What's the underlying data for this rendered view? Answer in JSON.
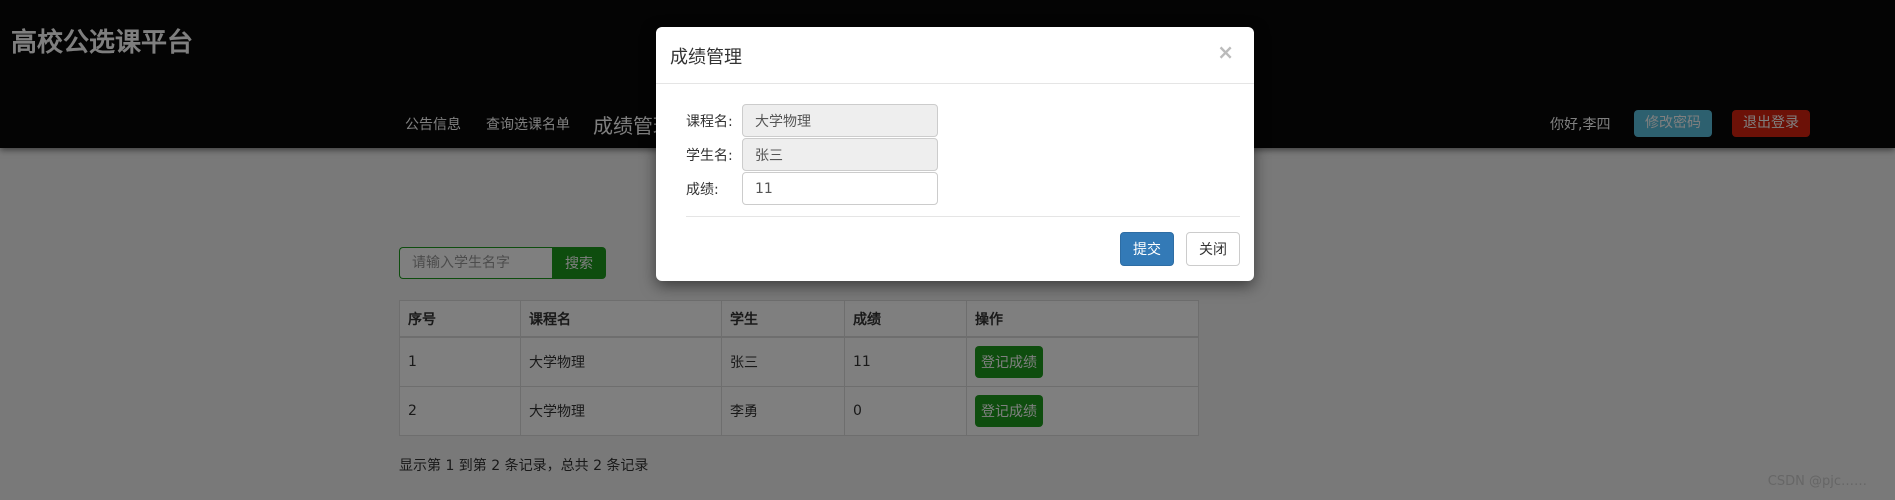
{
  "header": {
    "title": "高校公选课平台",
    "nav": [
      "公告信息",
      "查询选课名单",
      "成绩管理"
    ],
    "greeting": "你好,李四",
    "change_password": "修改密码",
    "logout": "退出登录"
  },
  "search": {
    "placeholder": "请输入学生名字",
    "button": "搜索"
  },
  "table": {
    "headers": [
      "序号",
      "课程名",
      "学生",
      "成绩",
      "操作"
    ],
    "rows": [
      {
        "index": "1",
        "course": "大学物理",
        "student": "张三",
        "score": "11",
        "action": "登记成绩"
      },
      {
        "index": "2",
        "course": "大学物理",
        "student": "李勇",
        "score": "0",
        "action": "登记成绩"
      }
    ]
  },
  "pagination": {
    "info": "显示第 1 到第 2 条记录，总共 2 条记录"
  },
  "watermark": "CSDN @pjc……",
  "modal": {
    "title": "成绩管理",
    "close_symbol": "×",
    "fields": [
      {
        "label": "课程名:",
        "value": "大学物理"
      },
      {
        "label": "学生名:",
        "value": "张三"
      },
      {
        "label": "成绩:",
        "value": "11"
      }
    ],
    "submit": "提交",
    "close": "关闭"
  },
  "colors": {
    "header_bg": "#080808",
    "success": "#1c9a1c",
    "info": "#5bc0de",
    "danger": "#d9230f",
    "primary": "#337ab7"
  }
}
